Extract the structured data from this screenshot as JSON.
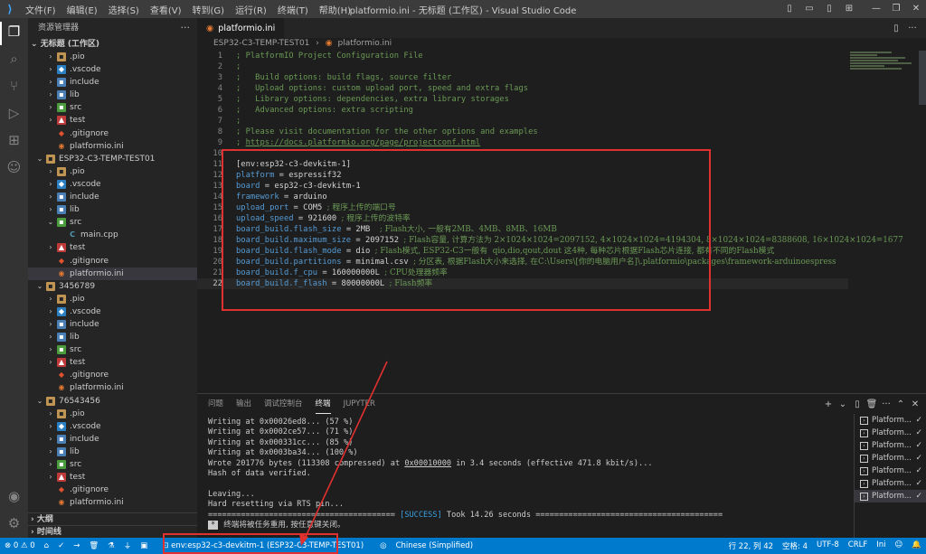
{
  "titlebar": {
    "menus": [
      "文件(F)",
      "编辑(E)",
      "选择(S)",
      "查看(V)",
      "转到(G)",
      "运行(R)",
      "终端(T)",
      "帮助(H)"
    ],
    "title": "platformio.ini - 无标题 (工作区) - Visual Studio Code"
  },
  "sidebar": {
    "title": "资源管理器",
    "workspace": "无标题 (工作区)",
    "tree": [
      {
        "indent": 1,
        "chev": "›",
        "icon": "folder",
        "label": ".pio"
      },
      {
        "indent": 1,
        "chev": "›",
        "icon": "vscode",
        "label": ".vscode"
      },
      {
        "indent": 1,
        "chev": "›",
        "icon": "include",
        "label": "include"
      },
      {
        "indent": 1,
        "chev": "›",
        "icon": "lib",
        "label": "lib"
      },
      {
        "indent": 1,
        "chev": "›",
        "icon": "src",
        "label": "src"
      },
      {
        "indent": 1,
        "chev": "›",
        "icon": "test",
        "label": "test"
      },
      {
        "indent": 1,
        "chev": "",
        "icon": "git",
        "label": ".gitignore"
      },
      {
        "indent": 1,
        "chev": "",
        "icon": "ini",
        "label": "platformio.ini"
      },
      {
        "indent": 0,
        "chev": "⌄",
        "icon": "folder",
        "label": "ESP32-C3-TEMP-TEST01"
      },
      {
        "indent": 1,
        "chev": "›",
        "icon": "folder",
        "label": ".pio"
      },
      {
        "indent": 1,
        "chev": "›",
        "icon": "vscode",
        "label": ".vscode"
      },
      {
        "indent": 1,
        "chev": "›",
        "icon": "include",
        "label": "include"
      },
      {
        "indent": 1,
        "chev": "›",
        "icon": "lib",
        "label": "lib"
      },
      {
        "indent": 1,
        "chev": "⌄",
        "icon": "src",
        "label": "src"
      },
      {
        "indent": 2,
        "chev": "",
        "icon": "cpp",
        "label": "main.cpp"
      },
      {
        "indent": 1,
        "chev": "›",
        "icon": "test",
        "label": "test"
      },
      {
        "indent": 1,
        "chev": "",
        "icon": "git",
        "label": ".gitignore"
      },
      {
        "indent": 1,
        "chev": "",
        "icon": "ini",
        "label": "platformio.ini",
        "selected": true
      },
      {
        "indent": 0,
        "chev": "⌄",
        "icon": "folder",
        "label": "3456789"
      },
      {
        "indent": 1,
        "chev": "›",
        "icon": "folder",
        "label": ".pio"
      },
      {
        "indent": 1,
        "chev": "›",
        "icon": "vscode",
        "label": ".vscode"
      },
      {
        "indent": 1,
        "chev": "›",
        "icon": "include",
        "label": "include"
      },
      {
        "indent": 1,
        "chev": "›",
        "icon": "lib",
        "label": "lib"
      },
      {
        "indent": 1,
        "chev": "›",
        "icon": "src",
        "label": "src"
      },
      {
        "indent": 1,
        "chev": "›",
        "icon": "test",
        "label": "test"
      },
      {
        "indent": 1,
        "chev": "",
        "icon": "git",
        "label": ".gitignore"
      },
      {
        "indent": 1,
        "chev": "",
        "icon": "ini",
        "label": "platformio.ini"
      },
      {
        "indent": 0,
        "chev": "⌄",
        "icon": "folder",
        "label": "76543456"
      },
      {
        "indent": 1,
        "chev": "›",
        "icon": "folder",
        "label": ".pio"
      },
      {
        "indent": 1,
        "chev": "›",
        "icon": "vscode",
        "label": ".vscode"
      },
      {
        "indent": 1,
        "chev": "›",
        "icon": "include",
        "label": "include"
      },
      {
        "indent": 1,
        "chev": "›",
        "icon": "lib",
        "label": "lib"
      },
      {
        "indent": 1,
        "chev": "›",
        "icon": "src",
        "label": "src"
      },
      {
        "indent": 1,
        "chev": "›",
        "icon": "test",
        "label": "test"
      },
      {
        "indent": 1,
        "chev": "",
        "icon": "git",
        "label": ".gitignore"
      },
      {
        "indent": 1,
        "chev": "",
        "icon": "ini",
        "label": "platformio.ini"
      }
    ],
    "outline": "大纲",
    "timeline": "时间线"
  },
  "editor": {
    "tab_label": "platformio.ini",
    "breadcrumb": [
      "ESP32-C3-TEMP-TEST01",
      "platformio.ini"
    ],
    "current_line": 22,
    "lines": [
      [
        {
          "t": "; PlatformIO Project Configuration File",
          "c": "comment"
        }
      ],
      [
        {
          "t": ";",
          "c": "comment"
        }
      ],
      [
        {
          "t": ";   Build options: build flags, source filter",
          "c": "comment"
        }
      ],
      [
        {
          "t": ";   Upload options: custom upload port, speed and extra flags",
          "c": "comment"
        }
      ],
      [
        {
          "t": ";   Library options: dependencies, extra library storages",
          "c": "comment"
        }
      ],
      [
        {
          "t": ";   Advanced options: extra scripting",
          "c": "comment"
        }
      ],
      [
        {
          "t": ";",
          "c": "comment"
        }
      ],
      [
        {
          "t": "; Please visit documentation for the other options and examples",
          "c": "comment"
        }
      ],
      [
        {
          "t": "; ",
          "c": "comment"
        },
        {
          "t": "https://docs.platformio.org/page/projectconf.html",
          "c": "link"
        }
      ],
      [],
      [
        {
          "t": "[env:esp32-c3-devkitm-1]",
          "c": "section"
        }
      ],
      [
        {
          "t": "platform",
          "c": "key"
        },
        {
          "t": " = espressif32",
          "c": "val"
        }
      ],
      [
        {
          "t": "board",
          "c": "key"
        },
        {
          "t": " = esp32-c3-devkitm-1",
          "c": "val"
        }
      ],
      [
        {
          "t": "framework",
          "c": "key"
        },
        {
          "t": " = arduino",
          "c": "val"
        }
      ],
      [
        {
          "t": "upload_port",
          "c": "key"
        },
        {
          "t": " = COM5 ",
          "c": "val"
        },
        {
          "t": "; 程序上传的端口号",
          "c": "cjk"
        }
      ],
      [
        {
          "t": "upload_speed",
          "c": "key"
        },
        {
          "t": " = 921600 ",
          "c": "val"
        },
        {
          "t": "; 程序上传的波特率",
          "c": "cjk"
        }
      ],
      [
        {
          "t": "board_build.flash_size",
          "c": "key"
        },
        {
          "t": " = 2MB  ",
          "c": "val"
        },
        {
          "t": "; Flash大小, 一般有2MB、4MB、8MB、16MB",
          "c": "cjk"
        }
      ],
      [
        {
          "t": "board_build.maximum_size",
          "c": "key"
        },
        {
          "t": " = 2097152 ",
          "c": "val"
        },
        {
          "t": "; Flash容量, 计算方法为 2×1024×1024=2097152, 4×1024×1024=4194304, 8×1024×1024=8388608, 16×1024×1024=1677",
          "c": "cjk"
        }
      ],
      [
        {
          "t": "board_build.flash_mode",
          "c": "key"
        },
        {
          "t": " = dio ",
          "c": "val"
        },
        {
          "t": "; Flash模式, ESP32-C3一般有  qio,dio,qout,dout 这4种, 每种芯片根据Flash芯片连接, 都有不同的Flash模式",
          "c": "cjk"
        }
      ],
      [
        {
          "t": "board_build.partitions",
          "c": "key"
        },
        {
          "t": " = minimal.csv ",
          "c": "val"
        },
        {
          "t": "; 分区表, 根据Flash大小来选择, 在C:\\Users\\[你的电脑用户名]\\.platformio\\packages\\framework-arduinoespress",
          "c": "cjk"
        }
      ],
      [
        {
          "t": "board_build.f_cpu",
          "c": "key"
        },
        {
          "t": " = 160000000L ",
          "c": "val"
        },
        {
          "t": "; CPU处理器频率",
          "c": "cjk"
        }
      ],
      [
        {
          "t": "board_build.f_flash",
          "c": "key"
        },
        {
          "t": " = 80000000L ",
          "c": "val"
        },
        {
          "t": "; Flash频率",
          "c": "cjk"
        }
      ]
    ]
  },
  "panel": {
    "tabs": [
      "问题",
      "输出",
      "调试控制台",
      "终端",
      "JUPYTER"
    ],
    "active_tab": 3,
    "terminal_lines": [
      "Writing at 0x00026ed8... (57 %)",
      "Writing at 0x0002ce57... (71 %)",
      "Writing at 0x000331cc... (85 %)",
      "Writing at 0x0003ba34... (100 %)",
      "Wrote 201776 bytes (113308 compressed) at |0x00010000| in 3.4 seconds (effective 471.8 kbit/s)...",
      "Hash of data verified.",
      "",
      "Leaving...",
      "Hard resetting via RTS pin...",
      "======================================== [SUCCESS] Took 14.26 seconds ========================================"
    ],
    "terminal_msg_badge": "*",
    "terminal_msg": "终端将被任务重用, 按任意键关闭。",
    "terminal_instances": [
      "Platform...",
      "Platform...",
      "Platform...",
      "Platform...",
      "Platform...",
      "Platform...",
      "Platform..."
    ]
  },
  "statusbar": {
    "errors": "0",
    "warnings": "0",
    "env": "env:esp32-c3-devkitm-1 (ESP32-C3-TEMP-TEST01)",
    "language_pack": "Chinese (Simplified)",
    "position": "行 22, 列 42",
    "spaces": "空格: 4",
    "encoding": "UTF-8",
    "eol": "CRLF",
    "language": "Ini"
  },
  "colors": {
    "accent": "#007acc",
    "annotation": "#e03030"
  }
}
